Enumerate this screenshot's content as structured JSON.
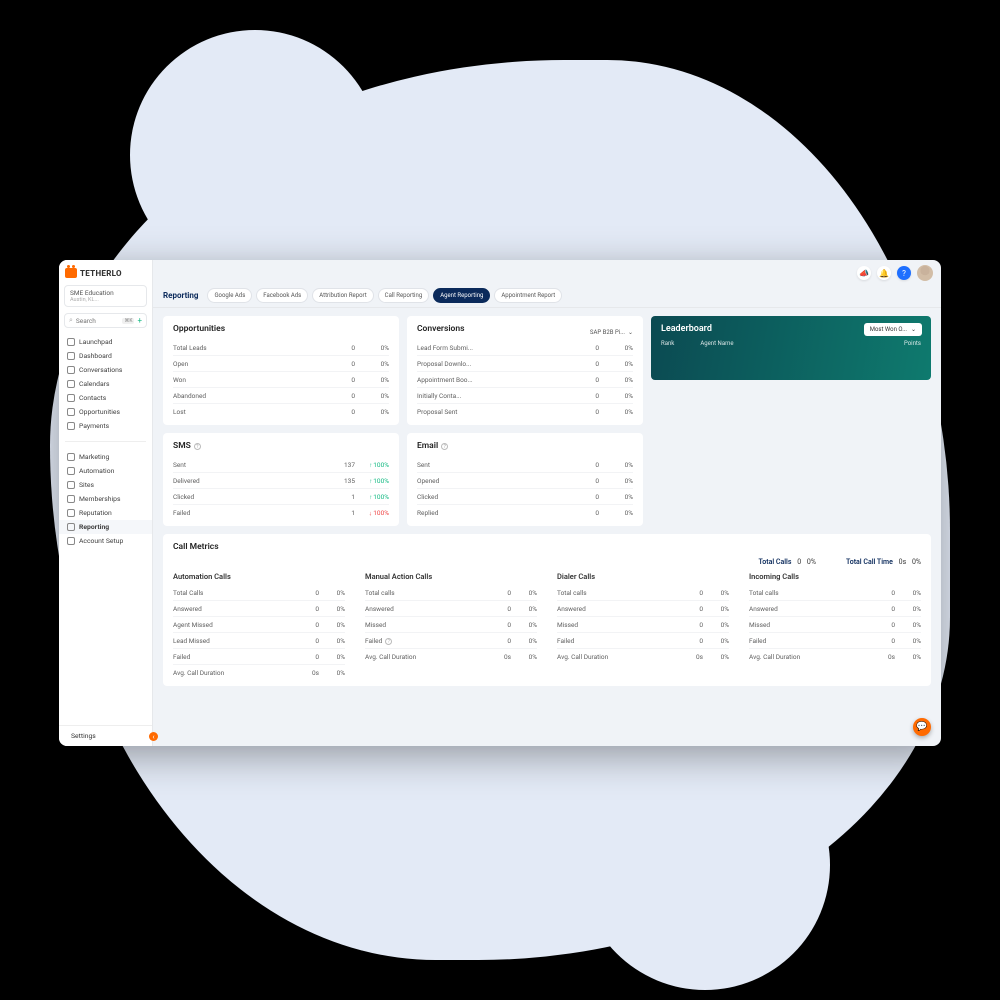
{
  "brand": "TETHERLO",
  "account": {
    "name": "SME Education",
    "sub": "Austin, KL..."
  },
  "search": {
    "placeholder": "Search",
    "shortcut": "⌘K"
  },
  "nav": {
    "primary": [
      {
        "label": "Launchpad"
      },
      {
        "label": "Dashboard"
      },
      {
        "label": "Conversations"
      },
      {
        "label": "Calendars"
      },
      {
        "label": "Contacts"
      },
      {
        "label": "Opportunities"
      },
      {
        "label": "Payments"
      }
    ],
    "secondary": [
      {
        "label": "Marketing"
      },
      {
        "label": "Automation"
      },
      {
        "label": "Sites"
      },
      {
        "label": "Memberships"
      },
      {
        "label": "Reputation"
      },
      {
        "label": "Reporting",
        "active": true
      },
      {
        "label": "Account Setup"
      }
    ],
    "settings": "Settings"
  },
  "page_title": "Reporting",
  "tabs": [
    "Google Ads",
    "Facebook Ads",
    "Attribution Report",
    "Call Reporting",
    "Agent Reporting",
    "Appointment Report"
  ],
  "active_tab": "Agent Reporting",
  "breadcrumb": "",
  "leaderboard": {
    "title": "Leaderboard",
    "selector": "Most Won O...",
    "cols": [
      "Rank",
      "Agent Name",
      "Points"
    ]
  },
  "opportunities": {
    "title": "Opportunities",
    "rows": [
      {
        "label": "Total Leads",
        "v": "0",
        "p": "0%"
      },
      {
        "label": "Open",
        "v": "0",
        "p": "0%"
      },
      {
        "label": "Won",
        "v": "0",
        "p": "0%"
      },
      {
        "label": "Abandoned",
        "v": "0",
        "p": "0%"
      },
      {
        "label": "Lost",
        "v": "0",
        "p": "0%"
      }
    ]
  },
  "conversions": {
    "title": "Conversions",
    "selector": "SAP B2B Pi...",
    "rows": [
      {
        "label": "Lead Form Submi...",
        "v": "0",
        "p": "0%"
      },
      {
        "label": "Proposal Downlo...",
        "v": "0",
        "p": "0%"
      },
      {
        "label": "Appointment Boo...",
        "v": "0",
        "p": "0%"
      },
      {
        "label": "Initially Conta...",
        "v": "0",
        "p": "0%"
      },
      {
        "label": "Proposal Sent",
        "v": "0",
        "p": "0%"
      }
    ]
  },
  "sms": {
    "title": "SMS",
    "rows": [
      {
        "label": "Sent",
        "v": "137",
        "p": "100%",
        "dir": "up"
      },
      {
        "label": "Delivered",
        "v": "135",
        "p": "100%",
        "dir": "up"
      },
      {
        "label": "Clicked",
        "v": "1",
        "p": "100%",
        "dir": "up"
      },
      {
        "label": "Failed",
        "v": "1",
        "p": "100%",
        "dir": "down"
      }
    ]
  },
  "email": {
    "title": "Email",
    "rows": [
      {
        "label": "Sent",
        "v": "0",
        "p": "0%"
      },
      {
        "label": "Opened",
        "v": "0",
        "p": "0%"
      },
      {
        "label": "Clicked",
        "v": "0",
        "p": "0%"
      },
      {
        "label": "Replied",
        "v": "0",
        "p": "0%"
      }
    ]
  },
  "callmetrics": {
    "title": "Call Metrics",
    "summary": {
      "total_calls_label": "Total Calls",
      "total_calls": "0",
      "total_calls_pct": "0%",
      "total_time_label": "Total Call Time",
      "total_time": "0s",
      "total_time_pct": "0%"
    },
    "cols": [
      {
        "title": "Automation Calls",
        "rows": [
          {
            "label": "Total Calls",
            "v": "0",
            "p": "0%"
          },
          {
            "label": "Answered",
            "v": "0",
            "p": "0%"
          },
          {
            "label": "Agent Missed",
            "v": "0",
            "p": "0%"
          },
          {
            "label": "Lead Missed",
            "v": "0",
            "p": "0%"
          },
          {
            "label": "Failed",
            "v": "0",
            "p": "0%"
          },
          {
            "label": "Avg. Call Duration",
            "v": "0s",
            "p": "0%"
          }
        ]
      },
      {
        "title": "Manual Action Calls",
        "rows": [
          {
            "label": "Total calls",
            "v": "0",
            "p": "0%"
          },
          {
            "label": "Answered",
            "v": "0",
            "p": "0%"
          },
          {
            "label": "Missed",
            "v": "0",
            "p": "0%"
          },
          {
            "label": "Failed",
            "v": "0",
            "p": "0%",
            "info": true
          },
          {
            "label": "Avg. Call Duration",
            "v": "0s",
            "p": "0%"
          }
        ]
      },
      {
        "title": "Dialer Calls",
        "rows": [
          {
            "label": "Total calls",
            "v": "0",
            "p": "0%"
          },
          {
            "label": "Answered",
            "v": "0",
            "p": "0%"
          },
          {
            "label": "Missed",
            "v": "0",
            "p": "0%"
          },
          {
            "label": "Failed",
            "v": "0",
            "p": "0%"
          },
          {
            "label": "Avg. Call Duration",
            "v": "0s",
            "p": "0%"
          }
        ]
      },
      {
        "title": "Incoming Calls",
        "rows": [
          {
            "label": "Total calls",
            "v": "0",
            "p": "0%"
          },
          {
            "label": "Answered",
            "v": "0",
            "p": "0%"
          },
          {
            "label": "Missed",
            "v": "0",
            "p": "0%"
          },
          {
            "label": "Failed",
            "v": "0",
            "p": "0%"
          },
          {
            "label": "Avg. Call Duration",
            "v": "0s",
            "p": "0%"
          }
        ]
      }
    ]
  }
}
